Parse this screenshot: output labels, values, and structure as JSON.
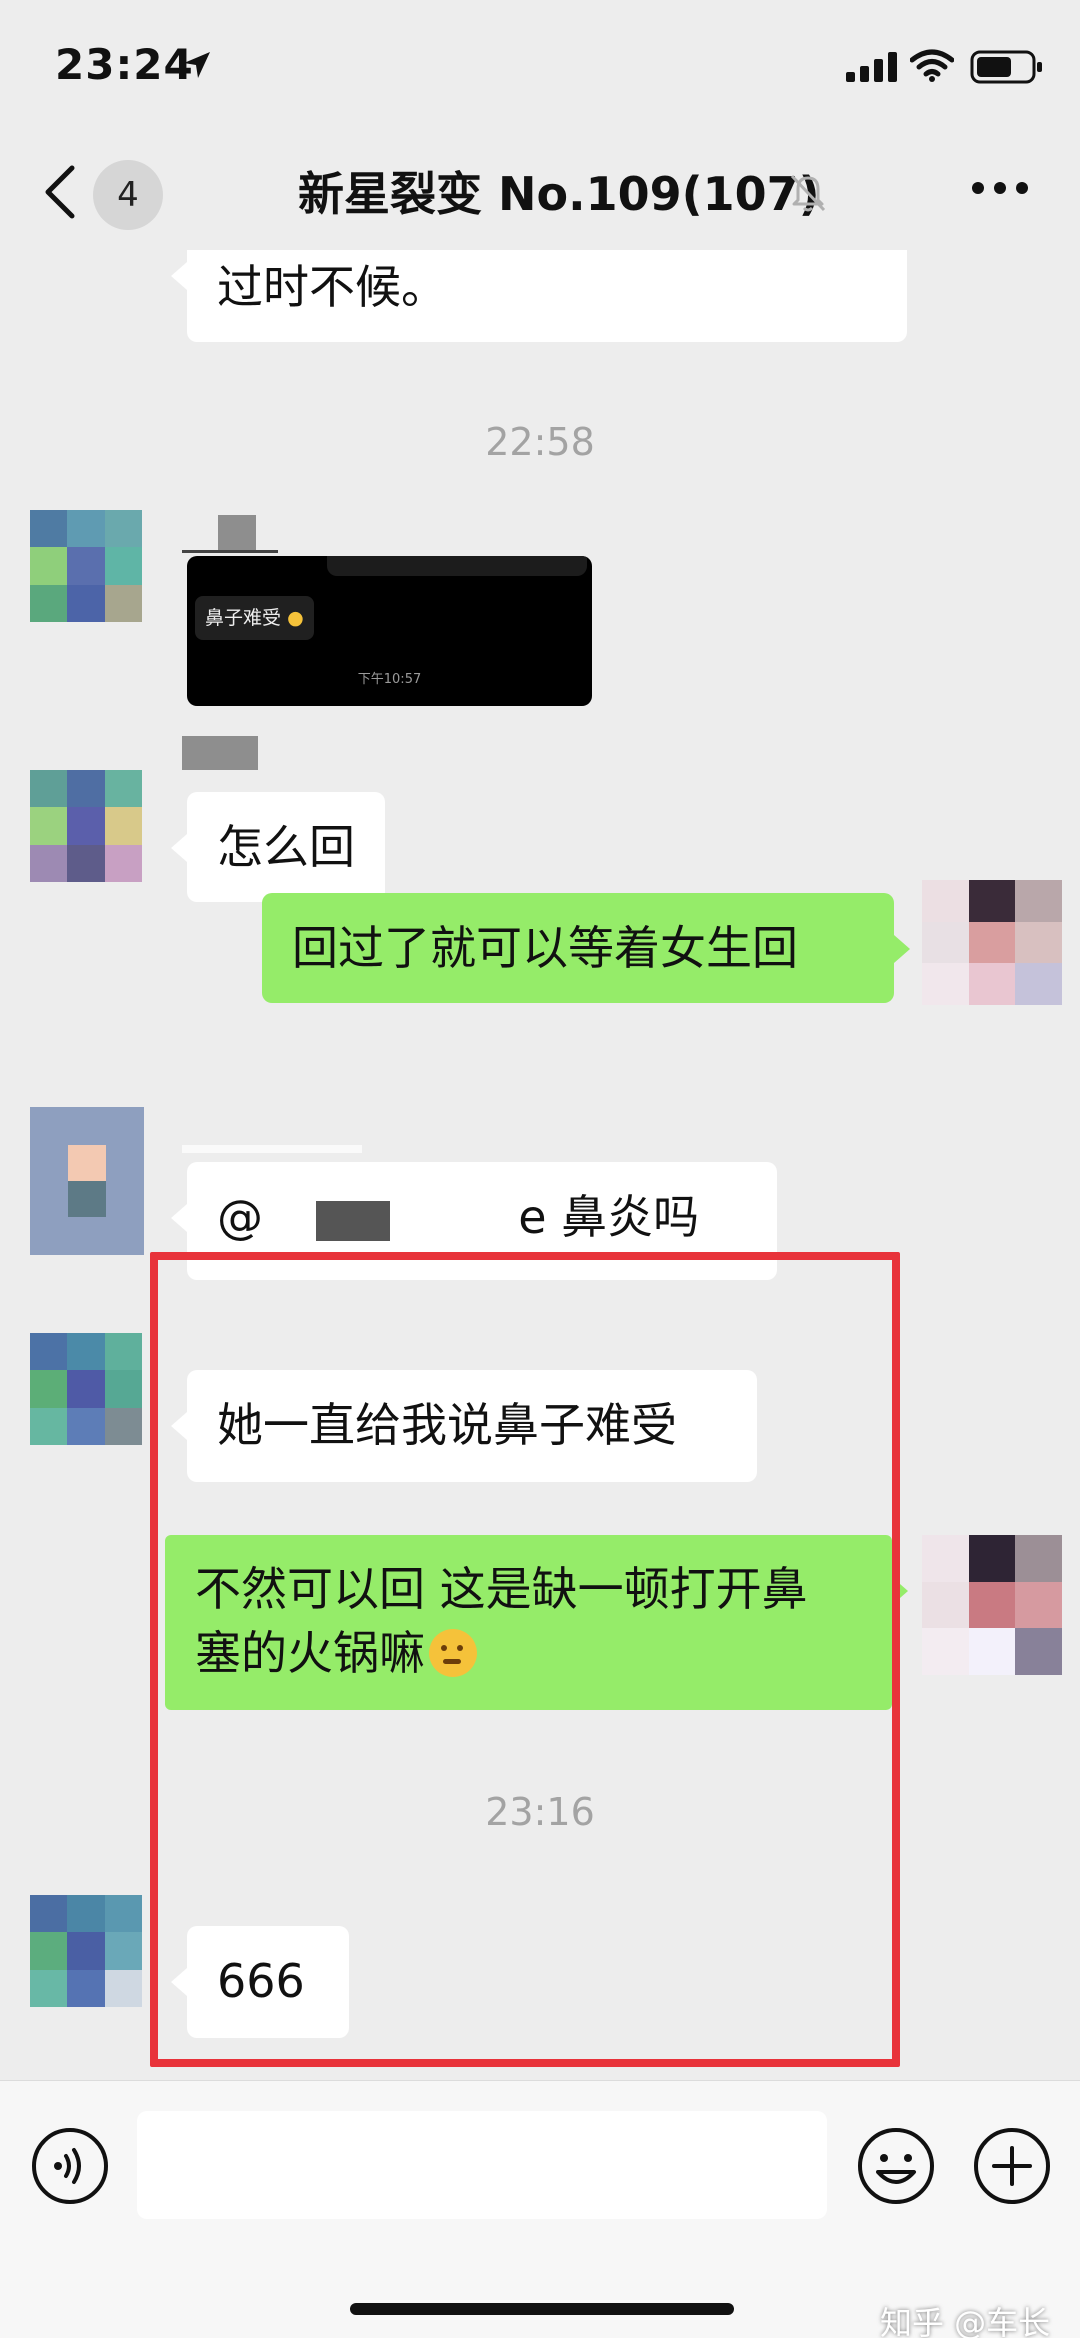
{
  "status_bar": {
    "time": "23:24"
  },
  "nav": {
    "unread_count": "4",
    "title": "新星裂变 No.109(107)"
  },
  "messages": {
    "m1_text": "过时不候。",
    "ts1": "22:58",
    "image_caption": "鼻子难受",
    "image_time": "下午10:57",
    "m2_text": "怎么回",
    "m3_text": "回过了就可以等着女生回",
    "m4_prefix": "@",
    "m4_suffix": "e 鼻炎吗",
    "m5_text": "她一直给我说鼻子难受",
    "m6_line1": "不然可以回 这是缺一顿打开鼻",
    "m6_line2": "塞的火锅嘛",
    "ts2": "23:16",
    "m7_text": "666"
  },
  "icons": {
    "status": [
      "location-arrow-icon",
      "signal-icon",
      "wifi-icon",
      "battery-icon"
    ],
    "nav": [
      "back-chevron-icon",
      "mute-bell-icon",
      "more-dots-icon"
    ],
    "input": [
      "voice-icon",
      "emoji-icon",
      "plus-icon"
    ]
  },
  "colors": {
    "background": "#ededed",
    "outgoing_bubble": "#95ec69",
    "incoming_bubble": "#ffffff",
    "highlight_border": "#e8333a",
    "timestamp": "#a3a3a3"
  },
  "watermark": "知乎 @车长"
}
